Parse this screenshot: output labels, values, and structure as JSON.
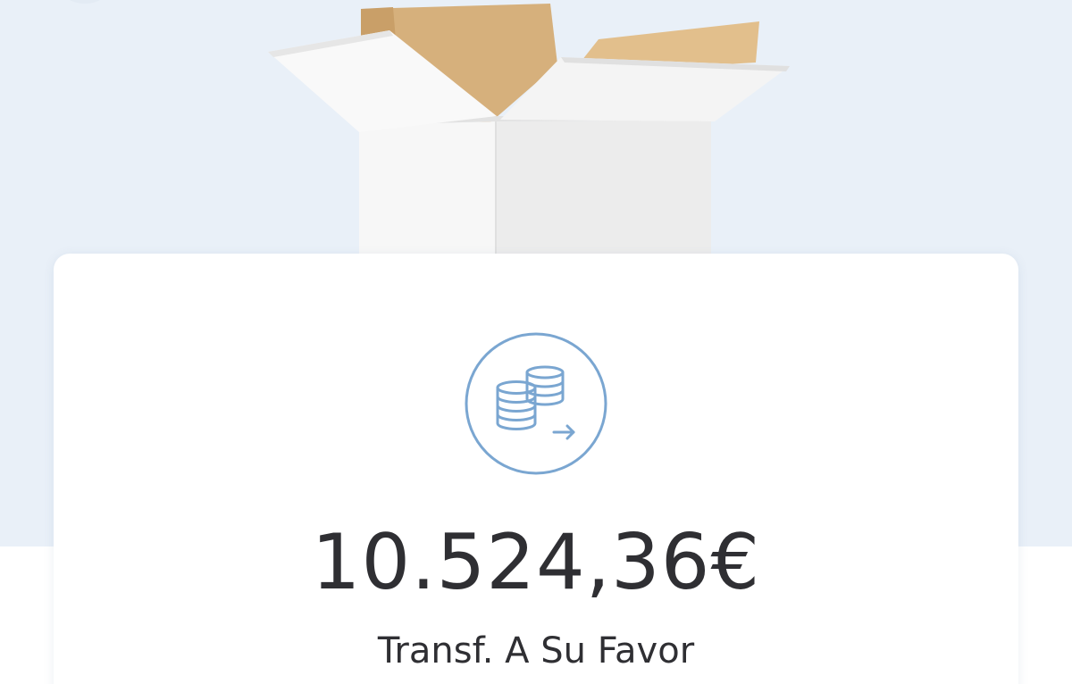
{
  "hero": {
    "illustration": "open-cardboard-box-icon",
    "background_color": "#e9f0f8"
  },
  "movement": {
    "icon": "coins-transfer-icon",
    "icon_color": "#7aa6d1",
    "amount": "10.524,36€",
    "concept": "Transf. A Su Favor"
  }
}
